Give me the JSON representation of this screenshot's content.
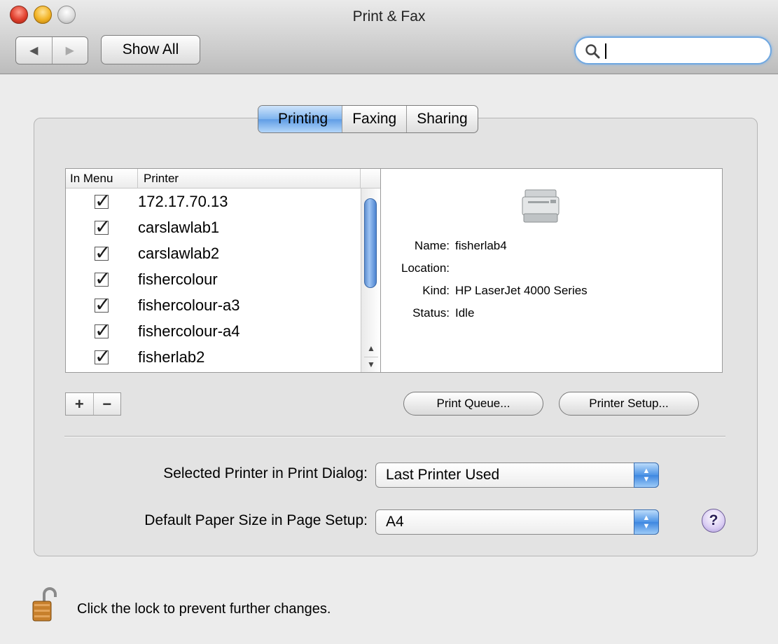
{
  "window": {
    "title": "Print & Fax"
  },
  "toolbar": {
    "back_icon": "back-arrow-icon",
    "forward_icon": "forward-arrow-icon",
    "show_all_label": "Show All",
    "search_value": ""
  },
  "tabs": [
    {
      "label": "Printing",
      "active": true
    },
    {
      "label": "Faxing",
      "active": false
    },
    {
      "label": "Sharing",
      "active": false
    }
  ],
  "printer_list": {
    "headers": [
      "In Menu",
      "Printer"
    ],
    "rows": [
      {
        "in_menu": true,
        "name": "172.17.70.13"
      },
      {
        "in_menu": true,
        "name": "carslawlab1"
      },
      {
        "in_menu": true,
        "name": "carslawlab2"
      },
      {
        "in_menu": true,
        "name": "fishercolour"
      },
      {
        "in_menu": true,
        "name": "fishercolour-a3"
      },
      {
        "in_menu": true,
        "name": "fishercolour-a4"
      },
      {
        "in_menu": true,
        "name": "fisherlab2"
      }
    ]
  },
  "details": {
    "name_label": "Name:",
    "name_value": "fisherlab4",
    "location_label": "Location:",
    "location_value": "",
    "kind_label": "Kind:",
    "kind_value": "HP LaserJet 4000 Series",
    "status_label": "Status:",
    "status_value": "Idle"
  },
  "buttons": {
    "add": "+",
    "remove": "−",
    "print_queue": "Print Queue...",
    "printer_setup": "Printer Setup..."
  },
  "settings": {
    "selected_printer_label": "Selected Printer in Print Dialog:",
    "selected_printer_value": "Last Printer Used",
    "paper_size_label": "Default Paper Size in Page Setup:",
    "paper_size_value": "A4"
  },
  "help": "?",
  "footer": {
    "lock_text": "Click the lock to prevent further changes."
  }
}
